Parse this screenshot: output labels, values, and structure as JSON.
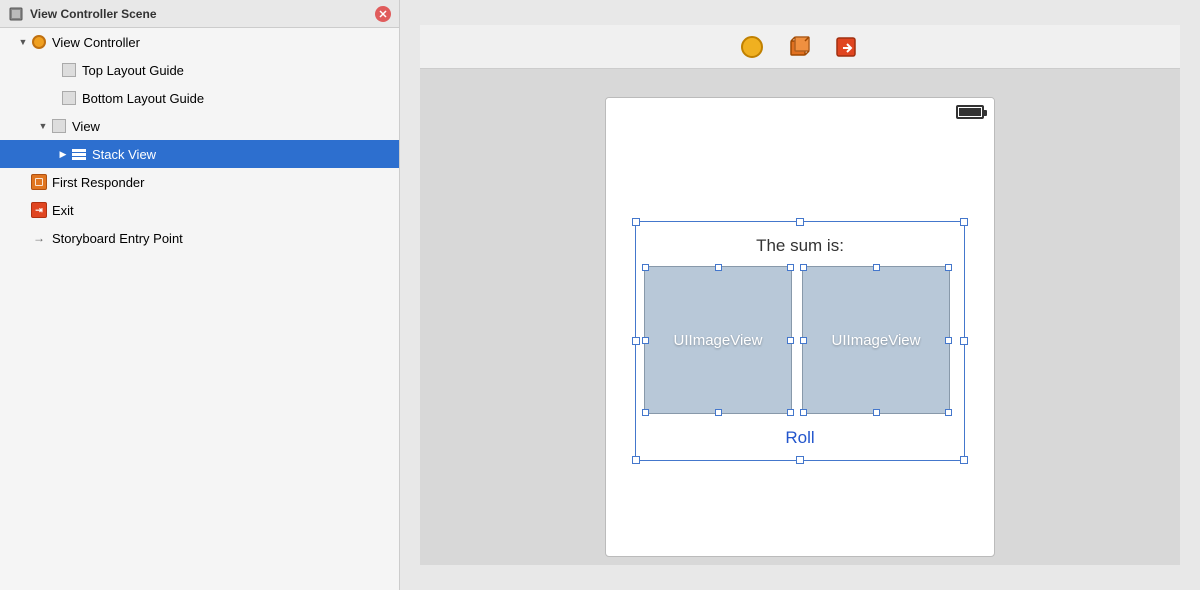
{
  "left_panel": {
    "scene": {
      "title": "View Controller Scene",
      "close_tooltip": "close"
    },
    "tree": {
      "items": [
        {
          "id": "view-controller",
          "label": "View Controller",
          "indent": 16,
          "expand": "open",
          "icon": "view-controller-icon",
          "selected": false
        },
        {
          "id": "top-layout-guide",
          "label": "Top Layout Guide",
          "indent": 46,
          "expand": "none",
          "icon": "small-rect-icon",
          "selected": false
        },
        {
          "id": "bottom-layout-guide",
          "label": "Bottom Layout Guide",
          "indent": 46,
          "expand": "none",
          "icon": "small-rect-icon",
          "selected": false
        },
        {
          "id": "view",
          "label": "View",
          "indent": 36,
          "expand": "open",
          "icon": "view-icon",
          "selected": false
        },
        {
          "id": "stack-view",
          "label": "Stack View",
          "indent": 56,
          "expand": "closed",
          "icon": "stack-view-icon",
          "selected": true
        },
        {
          "id": "first-responder",
          "label": "First Responder",
          "indent": 16,
          "expand": "none",
          "icon": "first-responder-icon",
          "selected": false
        },
        {
          "id": "exit",
          "label": "Exit",
          "indent": 16,
          "expand": "none",
          "icon": "exit-icon",
          "selected": false
        },
        {
          "id": "storyboard-entry",
          "label": "Storyboard Entry Point",
          "indent": 16,
          "expand": "none",
          "icon": "arrow-icon",
          "selected": false
        }
      ]
    }
  },
  "canvas": {
    "toolbar": {
      "btn1_icon": "yellow-circle-icon",
      "btn2_icon": "3d-box-icon",
      "btn3_icon": "square-arrow-icon"
    },
    "device": {
      "sum_label": "The sum is:",
      "image_view_1_label": "UIImageView",
      "image_view_2_label": "UIImageView",
      "roll_label": "Roll"
    }
  }
}
